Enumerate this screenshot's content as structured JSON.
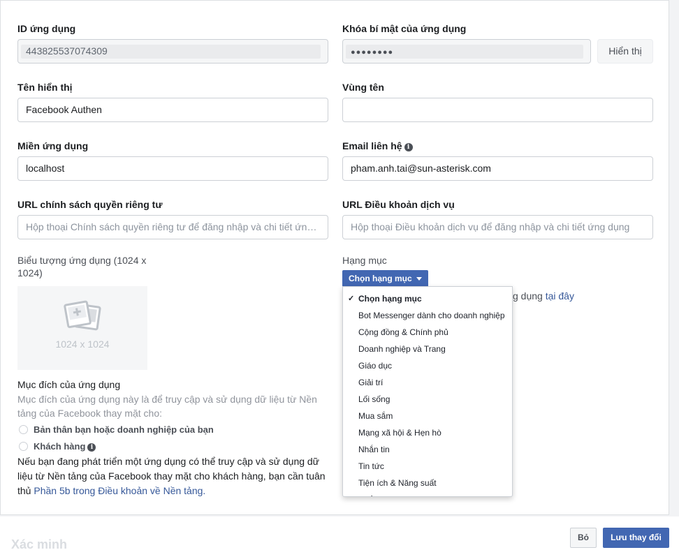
{
  "app_id": {
    "label": "ID ứng dụng",
    "value": "443825537074309"
  },
  "app_secret": {
    "label": "Khóa bí mật của ứng dụng",
    "value": "●●●●●●●●",
    "show_button": "Hiển thị"
  },
  "display_name": {
    "label": "Tên hiển thị",
    "value": "Facebook Authen"
  },
  "namespace": {
    "label": "Vùng tên",
    "value": ""
  },
  "app_domains": {
    "label": "Miền ứng dụng",
    "value": "localhost"
  },
  "contact_email": {
    "label": "Email liên hệ",
    "value": "pham.anh.tai@sun-asterisk.com",
    "info_glyph": "i"
  },
  "privacy_url": {
    "label": "URL chính sách quyền riêng tư",
    "placeholder": "Hộp thoại Chính sách quyền riêng tư để đăng nhập và chi tiết ứng dụng"
  },
  "tos_url": {
    "label": "URL Điều khoản dịch vụ",
    "placeholder": "Hộp thoại Điều khoản dịch vụ để đăng nhập và chi tiết ứng dụng"
  },
  "app_icon": {
    "label_line1": "Biểu tượng ứng dụng (1024 x",
    "label_line2": "1024)",
    "size_text": "1024 x 1024"
  },
  "purpose": {
    "label": "Mục đích của ứng dụng",
    "description": "Mục đích của ứng dụng này là để truy cập và sử dụng dữ liệu từ Nền tảng của Facebook thay mặt cho:",
    "option1": "Bản thân bạn hoặc doanh nghiệp của bạn",
    "option2": "Khách hàng",
    "info_glyph": "i",
    "note_text": "Nếu bạn đang phát triển một ứng dụng có thể truy cập và sử dụng dữ liệu từ Nền tảng của Facebook thay mặt cho khách hàng, bạn cần tuân thủ ",
    "note_link": "Phần 5b trong Điều khoản về Nền tảng."
  },
  "category": {
    "label": "Hạng mục",
    "button": "Chọn hạng mục",
    "behind_text": "g dụng ",
    "behind_link": "tại đây",
    "check_glyph": "✓",
    "items": [
      "Chọn hạng mục",
      "Bot Messenger dành cho doanh nghiệp",
      "Cộng đồng & Chính phủ",
      "Doanh nghiệp và Trang",
      "Giáo dục",
      "Giải trí",
      "Lối sống",
      "Mua sắm",
      "Mạng xã hội & Hẹn hò",
      "Nhắn tin",
      "Tin tức",
      "Tiện ích & Năng suất",
      "Thể thao"
    ]
  },
  "footer": {
    "verify": "Xác minh",
    "cancel": "Bỏ",
    "save": "Lưu thay đổi"
  }
}
